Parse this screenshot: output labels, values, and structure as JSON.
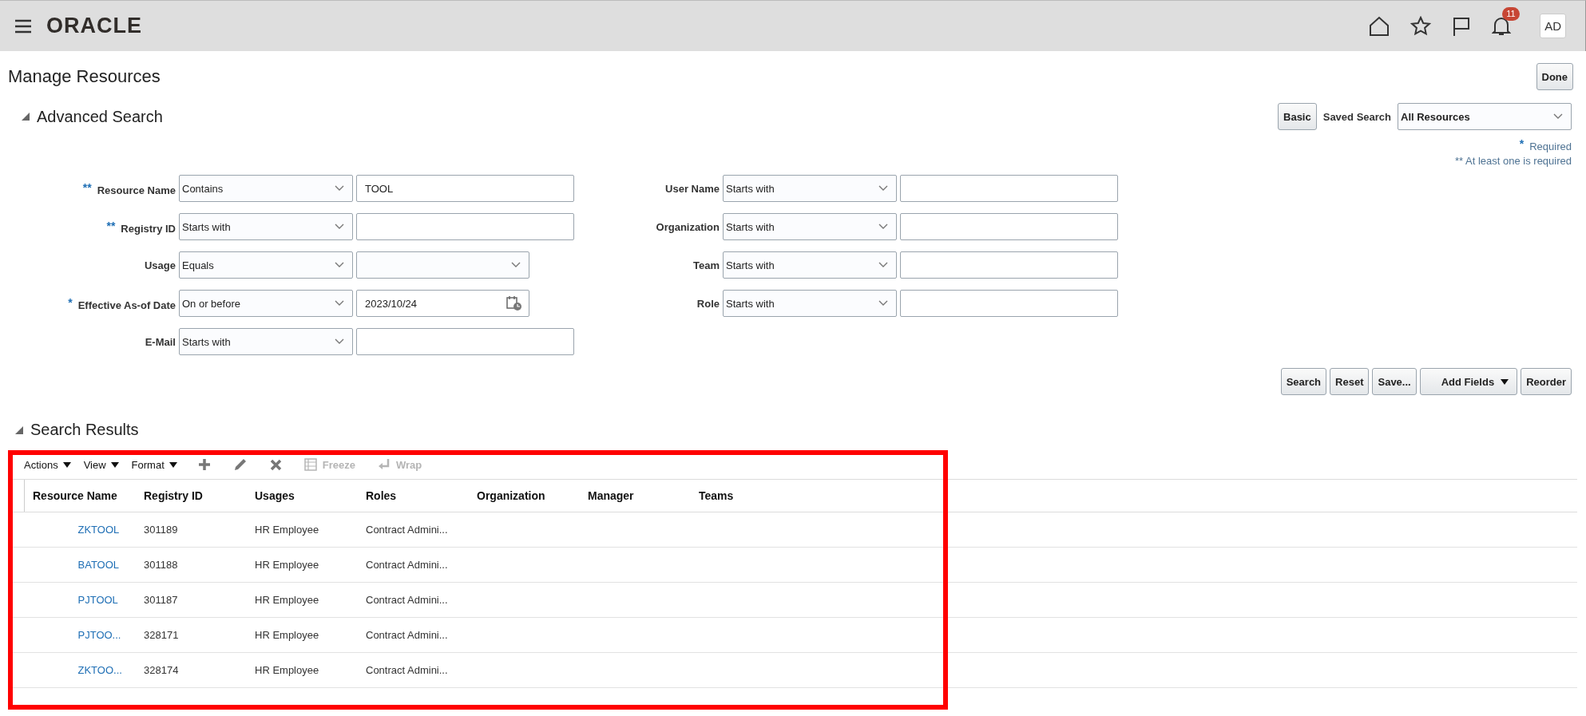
{
  "header": {
    "logo": "ORACLE",
    "notification_count": "11",
    "avatar": "AD"
  },
  "page": {
    "title": "Manage Resources",
    "done_button": "Done"
  },
  "advanced_search": {
    "title": "Advanced Search",
    "expanded": true,
    "basic_button": "Basic",
    "saved_search_label": "Saved Search",
    "saved_search_value": "All Resources",
    "required_mark": "*",
    "required_note": "Required",
    "at_least_one_note": "** At least one is required",
    "left_fields": [
      {
        "label": "Resource Name",
        "required_mark": "**",
        "operator": "Contains",
        "value": "TOOL",
        "kind": "text"
      },
      {
        "label": "Registry ID",
        "required_mark": "**",
        "operator": "Starts with",
        "kind": "text"
      },
      {
        "label": "Usage",
        "operator": "Equals",
        "kind": "select"
      },
      {
        "label": "Effective As-of Date",
        "required_mark": "*",
        "operator": "On or before",
        "value": "2023/10/24",
        "kind": "date"
      },
      {
        "label": "E-Mail",
        "operator": "Starts with",
        "kind": "text"
      }
    ],
    "right_fields": [
      {
        "label": "User Name",
        "operator": "Starts with",
        "kind": "text"
      },
      {
        "label": "Organization",
        "operator": "Starts with",
        "kind": "text"
      },
      {
        "label": "Team",
        "operator": "Starts with",
        "kind": "text"
      },
      {
        "label": "Role",
        "operator": "Starts with",
        "kind": "text"
      }
    ],
    "buttons": [
      {
        "label": "Search",
        "kind": "plain"
      },
      {
        "label": "Reset",
        "kind": "plain"
      },
      {
        "label": "Save...",
        "kind": "plain"
      },
      {
        "label": "Add Fields",
        "kind": "menu"
      },
      {
        "label": "Reorder",
        "kind": "plain"
      }
    ]
  },
  "search_results": {
    "title": "Search Results",
    "expanded": true,
    "highlighted": true,
    "toolbar": {
      "menus": [
        "Actions",
        "View",
        "Format"
      ],
      "icon_buttons": [
        {
          "kind": "add",
          "disabled": false
        },
        {
          "kind": "edit",
          "disabled": false
        },
        {
          "kind": "delete",
          "disabled": false
        }
      ],
      "text_buttons": [
        {
          "label": "Freeze",
          "kind": "freeze",
          "disabled": true
        },
        {
          "label": "Wrap",
          "kind": "wrap",
          "disabled": true
        }
      ]
    },
    "table": {
      "columns": [
        "Resource Name",
        "Registry ID",
        "Usages",
        "Roles",
        "Organization",
        "Manager",
        "Teams"
      ],
      "rows": [
        {
          "resource_name": "ZKTOOL",
          "registry_id": "301189",
          "usages": "HR Employee",
          "roles": "Contract Admini..."
        },
        {
          "resource_name": "BATOOL",
          "registry_id": "301188",
          "usages": "HR Employee",
          "roles": "Contract Admini..."
        },
        {
          "resource_name": "PJTOOL",
          "registry_id": "301187",
          "usages": "HR Employee",
          "roles": "Contract Admini..."
        },
        {
          "resource_name": "PJTOO...",
          "registry_id": "328171",
          "usages": "HR Employee",
          "roles": "Contract Admini..."
        },
        {
          "resource_name": "ZKTOO...",
          "registry_id": "328174",
          "usages": "HR Employee",
          "roles": "Contract Admini..."
        }
      ]
    }
  }
}
